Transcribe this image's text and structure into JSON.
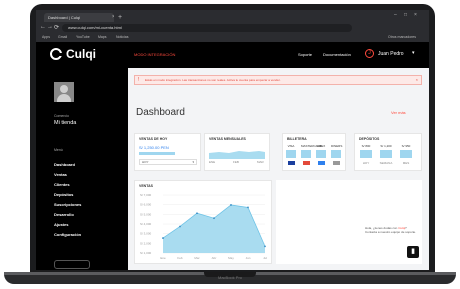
{
  "browser": {
    "tab_title": "Dashboard | Culqi",
    "tab_close": "×",
    "new_tab": "+",
    "window_controls": [
      "–",
      "□",
      "×"
    ],
    "nav": [
      "←",
      "→",
      "⟳"
    ],
    "url": "www.culqi.com/mi-cuenta.html",
    "bookmarks": [
      "Apps",
      "Gmail",
      "YouTube",
      "Maps",
      "Noticias",
      "Otros marcadores"
    ]
  },
  "topbar": {
    "brand": "Culqi",
    "mode": "MODO INTEGRACIÓN",
    "links": [
      "Soporte",
      "Documentación"
    ],
    "user_initial": "J",
    "user_name": "Juan Pedro",
    "caret": "▾"
  },
  "sidebar": {
    "business_label": "Comercio",
    "business_name": "Mi tienda",
    "section_label": "Menú",
    "items": [
      "Dashboard",
      "Ventas",
      "Clientes",
      "Depósitos",
      "Suscripciones",
      "Desarrollo",
      "Ajustes",
      "Configuración"
    ]
  },
  "alert": {
    "icon": "!",
    "text": "Estás en modo integración. Las transacciones no son reales. Activa tu cuenta para empezar a vender.",
    "close": "×"
  },
  "dashboard": {
    "title": "Dashboard",
    "link": "Ver más",
    "card_sales": {
      "title": "VENTAS DE HOY",
      "amount": "S/ 1,250.00 PEN",
      "period": "HOY",
      "caret": "▾",
      "fill": 0.62
    },
    "card_monthly": {
      "title": "VENTAS MENSUALES",
      "axis": [
        "ENE",
        "FEB",
        "MAR"
      ]
    },
    "card_wallet": {
      "title": "BILLETERA",
      "cols": [
        "VISA",
        "MASTERCARD",
        "AMEX",
        "DINERS"
      ]
    },
    "card_deposits": {
      "title": "DEPÓSITOS",
      "values": [
        "S/ 800",
        "S/ 1,200",
        "S/ 950"
      ],
      "labels": [
        "HOY",
        "SEMANA",
        "MES"
      ]
    },
    "big_chart_title": "VENTAS"
  },
  "chart_data": {
    "type": "area",
    "title": "VENTAS",
    "x": [
      "Ene",
      "Feb",
      "Mar",
      "Abr",
      "May",
      "Jun",
      "Jul"
    ],
    "values": [
      18,
      32,
      48,
      42,
      58,
      55,
      8
    ],
    "ylim": [
      0,
      70
    ],
    "y_ticks": [
      "S/ 7,000",
      "S/ 6,000",
      "S/ 5,000",
      "S/ 4,000",
      "S/ 3,000",
      "S/ 2,000",
      "S/ 1,000"
    ],
    "color": "#a9dcf0",
    "line_color": "#6fc3e6"
  },
  "help": {
    "text_prefix": "Hola, ¿tienes dudas con",
    "highlight": "Culqi",
    "text_suffix": "? Contacta a nuestro equipo de soporte.",
    "chat_icon": "💬"
  },
  "laptop": {
    "label": "MacBook Pro"
  }
}
